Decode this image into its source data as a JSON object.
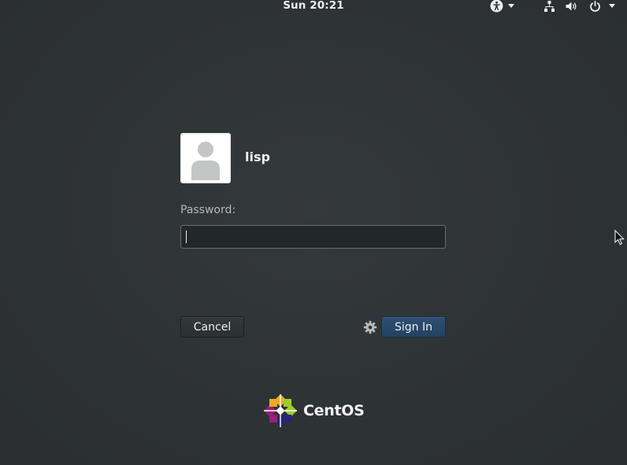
{
  "topbar": {
    "clock": "Sun 20:21",
    "icons": [
      "accessibility-icon",
      "network-icon",
      "volume-icon",
      "power-icon"
    ]
  },
  "login": {
    "username": "lisp",
    "password_label": "Password:",
    "password_value": "",
    "cancel_label": "Cancel",
    "signin_label": "Sign In"
  },
  "branding": {
    "name": "CentOS"
  },
  "colors": {
    "background": "#2e3436",
    "accent": "#2d4e73",
    "text": "#eeeeec"
  }
}
